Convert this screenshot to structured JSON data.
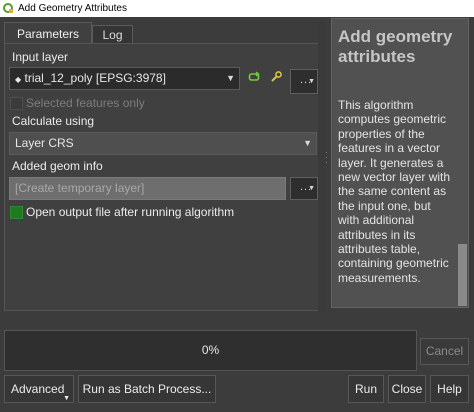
{
  "window": {
    "title": "Add Geometry Attributes"
  },
  "tabs": [
    {
      "label": "Parameters",
      "active": true
    },
    {
      "label": "Log",
      "active": false
    }
  ],
  "params": {
    "input_layer_label": "Input layer",
    "input_layer_value": "trial_12_poly [EPSG:3978]",
    "selected_only_label": "Selected features only",
    "selected_only_checked": false,
    "calc_label": "Calculate using",
    "calc_value": "Layer CRS",
    "added_geom_label": "Added geom info",
    "added_geom_placeholder": "[Create temporary layer]",
    "open_output_label": "Open output file after running algorithm",
    "open_output_checked": true,
    "dots": "..."
  },
  "help": {
    "title": "Add geometry attributes",
    "text": "This algorithm computes geometric properties of the features in a vector layer. It generates a new vector layer with the same content as the input one, but with additional attributes in its attributes table, containing geometric measurements."
  },
  "progress": {
    "text": "0%",
    "value": 0
  },
  "buttons": {
    "cancel": "Cancel",
    "advanced": "Advanced",
    "batch": "Run as Batch Process...",
    "run": "Run",
    "close": "Close",
    "help": "Help"
  },
  "colors": {
    "check_green": "#1f7a1f",
    "accent_green": "#6fcf3a",
    "accent_yellow": "#d8c24a"
  }
}
